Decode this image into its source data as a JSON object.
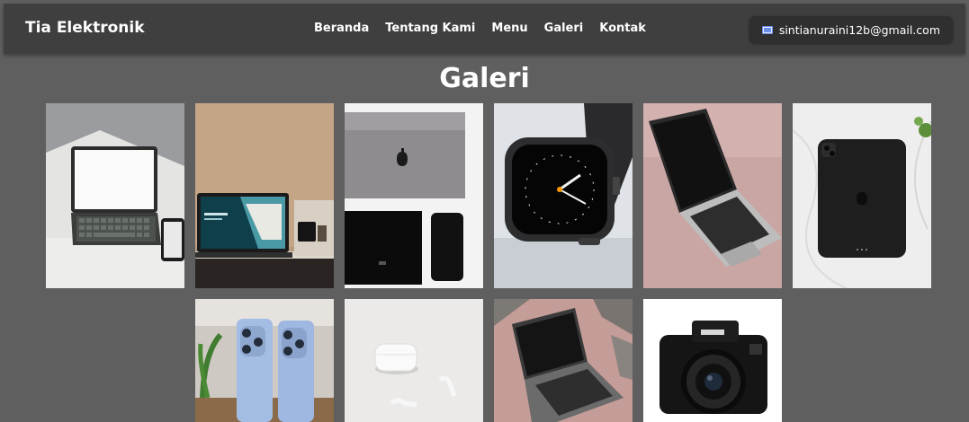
{
  "brand": "Tia Elektronik",
  "nav": [
    {
      "label": "Beranda"
    },
    {
      "label": "Tentang Kami"
    },
    {
      "label": "Menu"
    },
    {
      "label": "Galeri"
    },
    {
      "label": "Kontak"
    }
  ],
  "email": {
    "icon": "mail-icon",
    "text": "sintianuraini12b@gmail.com"
  },
  "page_title": "Galeri",
  "gallery": [
    {
      "subject": "tablet-keyboard-photo"
    },
    {
      "subject": "laptop-desk-photo"
    },
    {
      "subject": "apple-devices-photo"
    },
    {
      "subject": "smartwatch-photo"
    },
    {
      "subject": "macbook-pink-photo"
    },
    {
      "subject": "ipad-marble-photo"
    },
    {
      "subject": "iphone-photo"
    },
    {
      "subject": "airpods-photo"
    },
    {
      "subject": "laptop-pink-photo"
    },
    {
      "subject": "canon-camera-photo"
    }
  ],
  "colors": {
    "page_bg": "#5f5f5f",
    "navbar_bg": "#3f3f3f",
    "email_bg": "#2f2f2f",
    "text": "#ffffff"
  }
}
